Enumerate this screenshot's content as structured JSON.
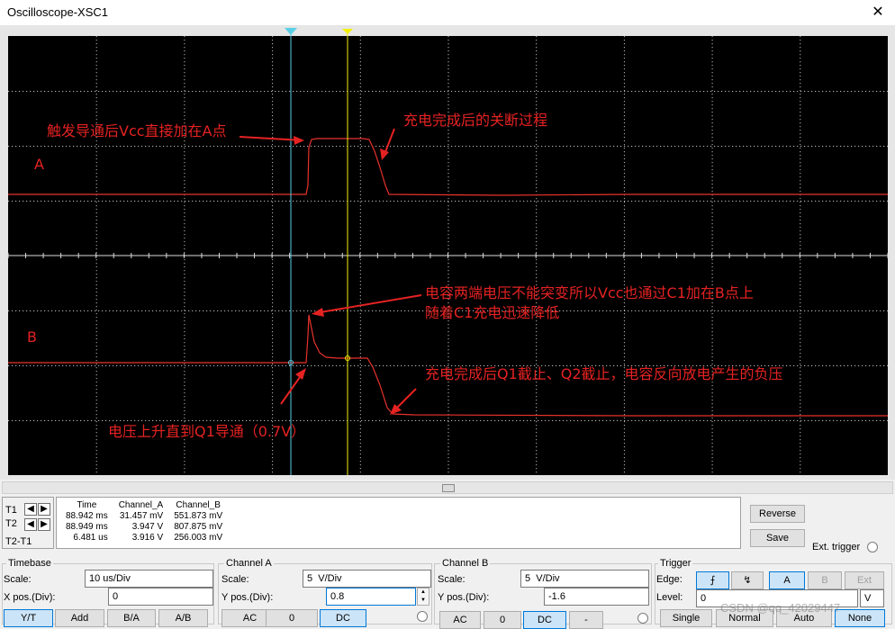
{
  "window": {
    "title": "Oscilloscope-XSC1",
    "close_label": "✕"
  },
  "colors": {
    "trace": "#e8322c",
    "cursor1": "#5ad0e6",
    "cursor2": "#f2f000",
    "grid": "#ffffff",
    "background": "#000000",
    "annotation": "#e52222"
  },
  "screen": {
    "channel_a_label": "A",
    "channel_b_label": "B",
    "annotations": {
      "a_trigger": "触发导通后Vcc直接加在A点",
      "a_turnoff": "充电完成后的关断过程",
      "b_cap_line1": "电容两端电压不能突变所以Vcc也通过C1加在B点上",
      "b_cap_line2": "随着C1充电迅速降低",
      "b_negative": "充电完成后Q1截止、Q2截止，电容反向放电产生的负压",
      "b_rise": "电压上升直到Q1导通（0.7V）"
    }
  },
  "readout": {
    "t1_label": "T1",
    "t2_label": "T2",
    "t2t1_label": "T2-T1",
    "headers": [
      "Time",
      "Channel_A",
      "Channel_B"
    ],
    "rows": [
      [
        "88.942 ms",
        "31.457 mV",
        "551.873 mV"
      ],
      [
        "88.949 ms",
        "3.947 V",
        "807.875 mV"
      ],
      [
        "6.481 us",
        "3.916 V",
        "256.003 mV"
      ]
    ]
  },
  "side_buttons": {
    "reverse": "Reverse",
    "save": "Save",
    "ext_trigger": "Ext. trigger"
  },
  "timebase": {
    "title": "Timebase",
    "scale_label": "Scale:",
    "scale_value": "10 us/Div",
    "xpos_label": "X pos.(Div):",
    "xpos_value": "0",
    "buttons": [
      "Y/T",
      "Add",
      "B/A",
      "A/B"
    ]
  },
  "channel_a": {
    "title": "Channel A",
    "scale_label": "Scale:",
    "scale_value": "5  V/Div",
    "ypos_label": "Y pos.(Div):",
    "ypos_value": "0.8",
    "buttons": [
      "AC",
      "0",
      "DC"
    ]
  },
  "channel_b": {
    "title": "Channel B",
    "scale_label": "Scale:",
    "scale_value": "5  V/Div",
    "ypos_label": "Y pos.(Div):",
    "ypos_value": "-1.6",
    "buttons": [
      "AC",
      "0",
      "DC",
      "-"
    ]
  },
  "trigger": {
    "title": "Trigger",
    "edge_label": "Edge:",
    "level_label": "Level:",
    "level_value": "0",
    "level_unit": "V",
    "source_buttons": [
      "A",
      "B",
      "Ext"
    ],
    "mode_buttons": [
      "Single",
      "Normal",
      "Auto",
      "None"
    ]
  },
  "watermark": "CSDN @qq_42029447"
}
